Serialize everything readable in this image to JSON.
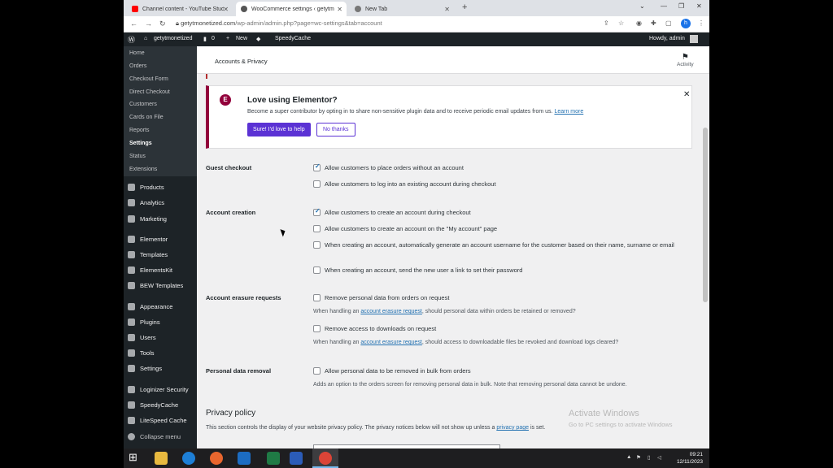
{
  "browser": {
    "tabs": [
      {
        "title": "Channel content - YouTube Studio",
        "icon": "youtube-icon",
        "active": false
      },
      {
        "title": "WooCommerce settings ‹ getytm",
        "icon": "wordpress-icon",
        "active": true
      },
      {
        "title": "New Tab",
        "icon": "chrome-icon",
        "active": false
      }
    ],
    "url_host": "getytmonetized.com",
    "url_path": "/wp-admin/admin.php?page=wc-settings&tab=account",
    "profile_initial": "h"
  },
  "adminbar": {
    "site": "getytmonetized",
    "comments": "0",
    "new": "New",
    "plugin": "SpeedyCache",
    "greeting": "Howdy, admin"
  },
  "sidebar": {
    "submenu": [
      "Home",
      "Orders",
      "Checkout Form",
      "Direct Checkout",
      "Customers",
      "Cards on File",
      "Reports",
      "Settings",
      "Status",
      "Extensions"
    ],
    "current": "Settings",
    "menu": [
      "Products",
      "Analytics",
      "Marketing",
      "Elementor",
      "Templates",
      "ElementsKit",
      "BEW Templates",
      "Appearance",
      "Plugins",
      "Users",
      "Tools",
      "Settings",
      "Loginizer Security",
      "SpeedyCache",
      "LiteSpeed Cache",
      "Collapse menu"
    ]
  },
  "header": {
    "title": "Accounts & Privacy",
    "activity": "Activity"
  },
  "notice": {
    "title": "Love using Elementor?",
    "text": "Become a super contributor by opting in to share non-sensitive plugin data and to receive periodic email updates from us.",
    "link": "Learn more",
    "accept": "Sure! I'd love to help",
    "decline": "No thanks"
  },
  "settings": {
    "guest_checkout": {
      "label": "Guest checkout",
      "options": [
        {
          "text": "Allow customers to place orders without an account",
          "checked": true
        },
        {
          "text": "Allow customers to log into an existing account during checkout",
          "checked": false
        }
      ]
    },
    "account_creation": {
      "label": "Account creation",
      "options": [
        {
          "text": "Allow customers to create an account during checkout",
          "checked": true
        },
        {
          "text": "Allow customers to create an account on the \"My account\" page",
          "checked": false
        },
        {
          "text": "When creating an account, automatically generate an account username for the customer based on their name, surname or email",
          "checked": false
        },
        {
          "text": "When creating an account, send the new user a link to set their password",
          "checked": false
        }
      ]
    },
    "erasure": {
      "label": "Account erasure requests",
      "opt1": "Remove personal data from orders on request",
      "desc1_pre": "When handling an ",
      "desc_link": "account erasure request",
      "desc1_post": ", should personal data within orders be retained or removed?",
      "opt2": "Remove access to downloads on request",
      "desc2_post": ", should access to downloadable files be revoked and download logs cleared?"
    },
    "removal": {
      "label": "Personal data removal",
      "opt": "Allow personal data to be removed in bulk from orders",
      "desc": "Adds an option to the orders screen for removing personal data in bulk. Note that removing personal data cannot be undone."
    },
    "privacy": {
      "title": "Privacy policy",
      "intro": "This section controls the display of your website privacy policy. The privacy notices below will not show up unless a ",
      "link": "privacy page",
      "intro_end": " is set."
    }
  },
  "watermark": {
    "line1": "Activate Windows",
    "line2": "Go to PC settings to activate Windows"
  },
  "taskbar": {
    "time": "09:21",
    "date": "12/11/2023"
  }
}
